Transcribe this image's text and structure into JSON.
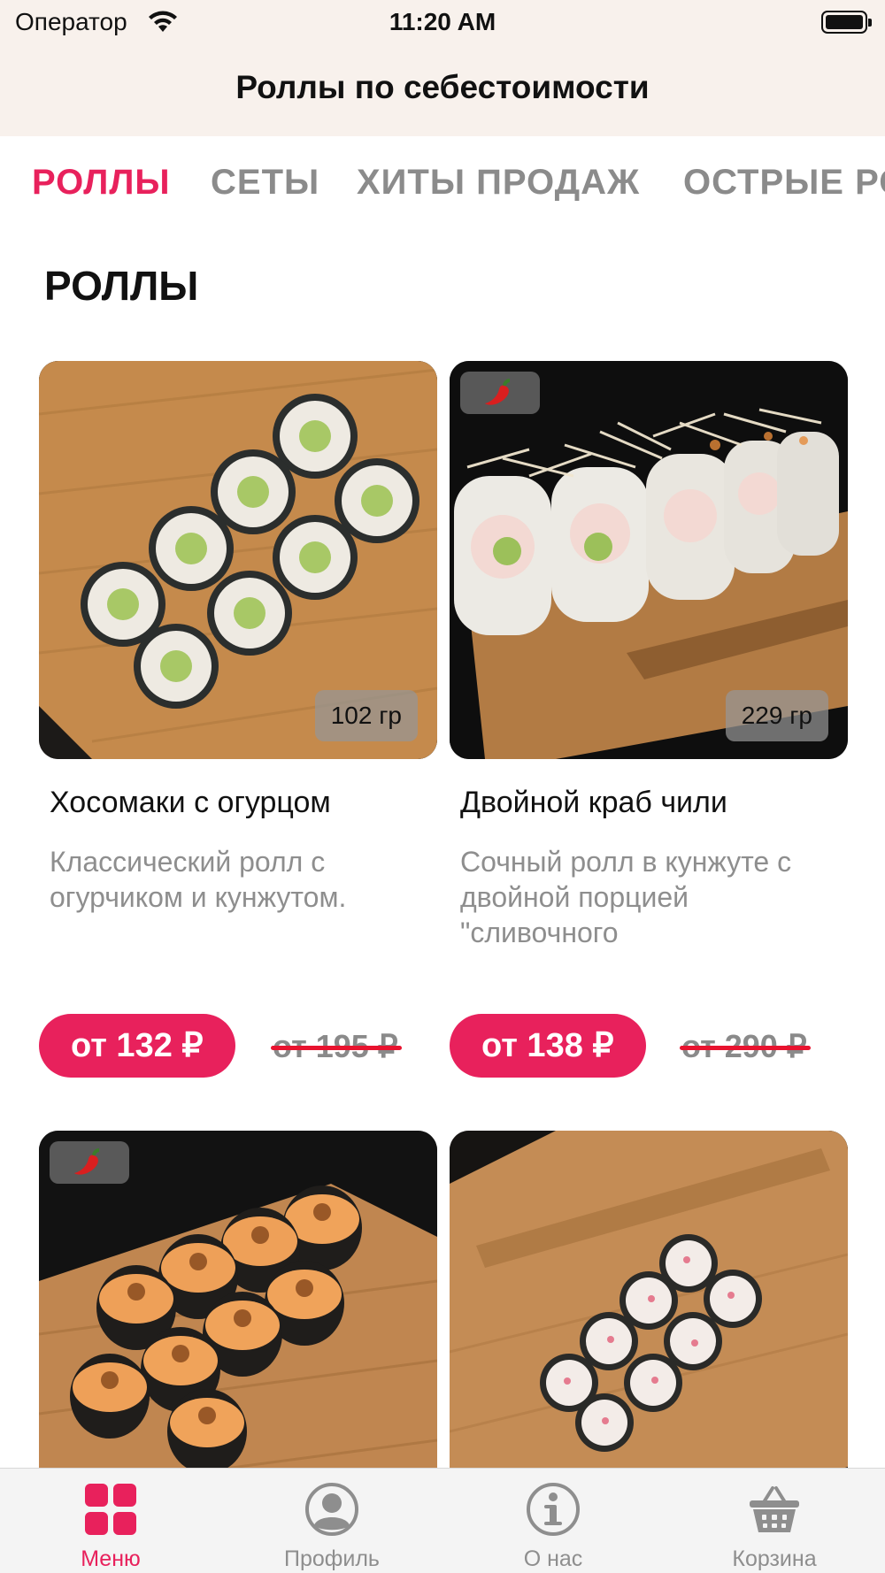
{
  "status_bar": {
    "carrier": "Оператор",
    "time": "11:20 AM"
  },
  "nav": {
    "title": "Роллы по себестоимости"
  },
  "categories": [
    {
      "label": "РОЛЛЫ",
      "active": true
    },
    {
      "label": "СЕТЫ",
      "active": false
    },
    {
      "label": "ХИТЫ ПРОДАЖ",
      "active": false
    },
    {
      "label": "ОСТРЫЕ РОЛЛЫ",
      "active": false
    }
  ],
  "section": {
    "title": "РОЛЛЫ"
  },
  "products": [
    {
      "name": "Хосомаки с огурцом",
      "description": "Классический ролл с огурчиком и кунжутом.",
      "weight": "102 гр",
      "price": "от 132 ₽",
      "old_price": "от 195 ₽",
      "spicy": false
    },
    {
      "name": "Двойной краб чили",
      "description": "Сочный ролл в кунжуте с двойной порцией \"сливочного",
      "weight": "229 гр",
      "price": "от 138 ₽",
      "old_price": "от 290 ₽",
      "spicy": true
    },
    {
      "spicy": true
    },
    {
      "spicy": false
    }
  ],
  "tabbar": [
    {
      "label": "Меню",
      "icon": "menu-grid-icon",
      "active": true
    },
    {
      "label": "Профиль",
      "icon": "profile-icon",
      "active": false
    },
    {
      "label": "О нас",
      "icon": "info-icon",
      "active": false
    },
    {
      "label": "Корзина",
      "icon": "basket-icon",
      "active": false
    }
  ],
  "colors": {
    "accent": "#e8215c",
    "header_bg": "#f8f1ec",
    "strike": "#e8132f",
    "tabbar_bg": "#f4f4f4"
  }
}
